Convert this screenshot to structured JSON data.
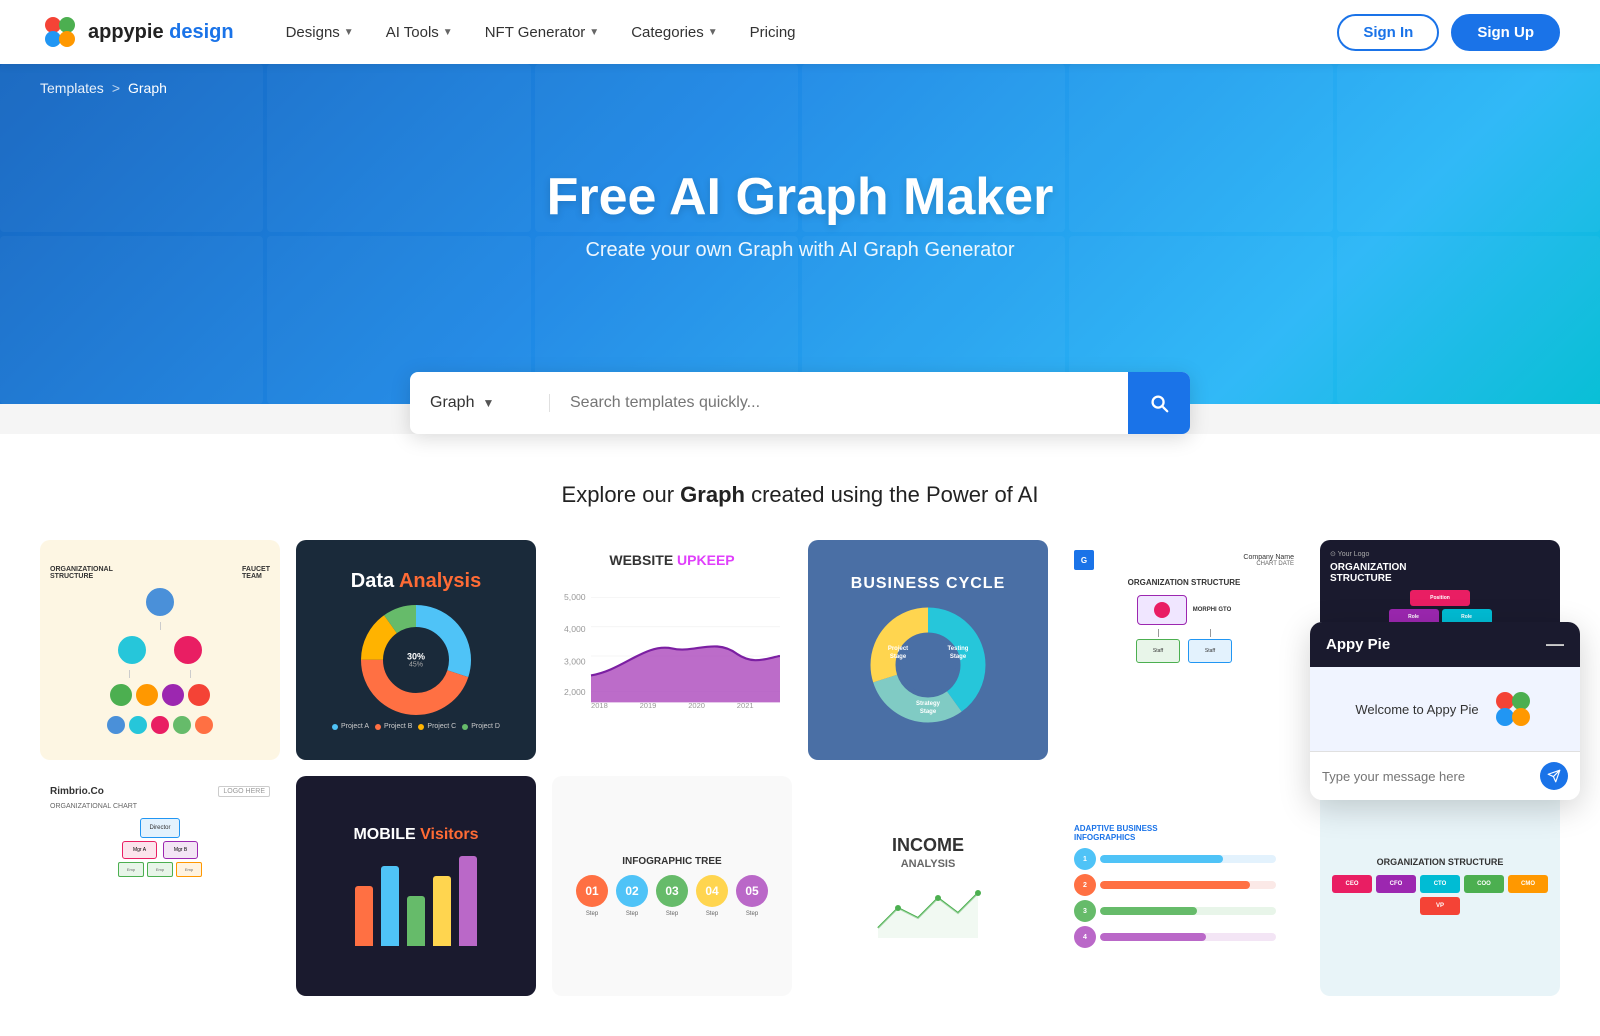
{
  "brand": {
    "name": "appypie design",
    "name_part1": "appypie",
    "name_part2": "design"
  },
  "navbar": {
    "designs_label": "Designs",
    "ai_tools_label": "AI Tools",
    "nft_generator_label": "NFT Generator",
    "categories_label": "Categories",
    "pricing_label": "Pricing",
    "signin_label": "Sign In",
    "signup_label": "Sign Up"
  },
  "breadcrumb": {
    "templates_label": "Templates",
    "separator": ">",
    "current_label": "Graph"
  },
  "hero": {
    "title": "Free AI Graph Maker",
    "subtitle": "Create your own Graph with AI Graph Generator"
  },
  "search": {
    "category_label": "Graph",
    "placeholder": "Search templates quickly..."
  },
  "section": {
    "title_part1": "Explore our",
    "title_bold": "Graph",
    "title_part2": "created using the Power of AI"
  },
  "templates": [
    {
      "id": "org-structure-cream",
      "label": "Organizational Structure"
    },
    {
      "id": "data-analysis",
      "label": "Data Analysis",
      "title_plain": "Data",
      "title_colored": "Analysis",
      "pie_segments": [
        {
          "label": "Project A",
          "value": 30,
          "color": "#4fc3f7"
        },
        {
          "label": "Project B",
          "value": 45,
          "color": "#ff7043"
        },
        {
          "label": "Project C",
          "value": 15,
          "color": "#ffb300"
        },
        {
          "label": "Project D",
          "value": 10,
          "color": "#66bb6a"
        }
      ],
      "segment_labels": [
        "30%",
        "45%",
        "15%",
        "10%"
      ]
    },
    {
      "id": "website-upkeep",
      "label": "Website Upkeep",
      "title_plain": "WEBSITE",
      "title_colored": "UPKEEP"
    },
    {
      "id": "business-cycle",
      "label": "BUSINESS CYCLE",
      "donut_segments": [
        {
          "label": "Project Stage",
          "color": "#26c6da"
        },
        {
          "label": "Testing Stage",
          "color": "#80cbc4"
        },
        {
          "label": "Strategy Stage",
          "color": "#ffd54f"
        }
      ]
    },
    {
      "id": "org-structure-blue",
      "label": "Organization Structure",
      "company_name": "Company Name",
      "sub_label": "CHART DATE",
      "org_title": "ORGANIZATION STRUCTURE"
    },
    {
      "id": "org-colorful",
      "label": "Organization Structure",
      "logo_text": "Your Logo",
      "title": "ORGANIZATION STRUCTURE",
      "box_colors": [
        "#e91e63",
        "#9c27b0",
        "#00bcd4",
        "#4caf50",
        "#ff9800",
        "#f44336"
      ]
    }
  ],
  "bottom_templates": [
    {
      "id": "rimbrio",
      "label": "Rimbrio.Co",
      "logo_label": "LOGO HERE"
    },
    {
      "id": "mobile-visitors",
      "label": "Mobile Visitors",
      "title_plain": "MOBILE",
      "title_colored": "Visitors"
    },
    {
      "id": "infographic-tree",
      "label": "Infographic Tree"
    },
    {
      "id": "income-analysis",
      "label": "INCOME ANALYSIS",
      "title": "INCOME"
    },
    {
      "id": "adaptive-biz",
      "label": "Adaptive Business Infographics"
    },
    {
      "id": "bottom-last",
      "label": "Organization Structure"
    }
  ],
  "chat": {
    "header_title": "Appy Pie",
    "welcome_text": "Welcome to Appy Pie",
    "input_placeholder": "Type your message here",
    "close_symbol": "—"
  }
}
